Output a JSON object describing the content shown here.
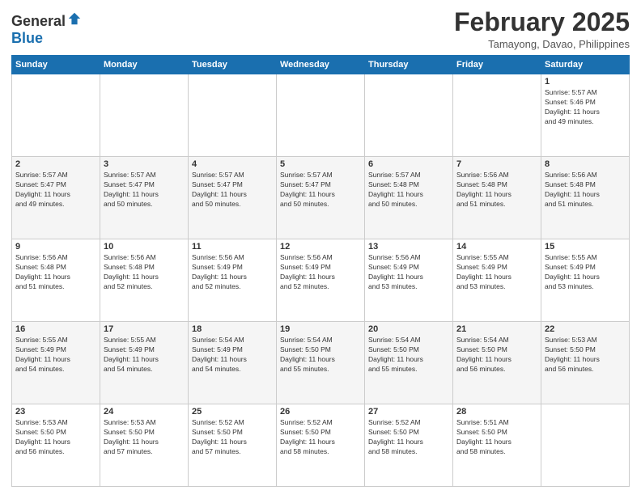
{
  "header": {
    "logo_general": "General",
    "logo_blue": "Blue",
    "month_title": "February 2025",
    "location": "Tamayong, Davao, Philippines"
  },
  "days_of_week": [
    "Sunday",
    "Monday",
    "Tuesday",
    "Wednesday",
    "Thursday",
    "Friday",
    "Saturday"
  ],
  "weeks": [
    [
      {
        "day": "",
        "info": ""
      },
      {
        "day": "",
        "info": ""
      },
      {
        "day": "",
        "info": ""
      },
      {
        "day": "",
        "info": ""
      },
      {
        "day": "",
        "info": ""
      },
      {
        "day": "",
        "info": ""
      },
      {
        "day": "1",
        "info": "Sunrise: 5:57 AM\nSunset: 5:46 PM\nDaylight: 11 hours\nand 49 minutes."
      }
    ],
    [
      {
        "day": "2",
        "info": "Sunrise: 5:57 AM\nSunset: 5:47 PM\nDaylight: 11 hours\nand 49 minutes."
      },
      {
        "day": "3",
        "info": "Sunrise: 5:57 AM\nSunset: 5:47 PM\nDaylight: 11 hours\nand 50 minutes."
      },
      {
        "day": "4",
        "info": "Sunrise: 5:57 AM\nSunset: 5:47 PM\nDaylight: 11 hours\nand 50 minutes."
      },
      {
        "day": "5",
        "info": "Sunrise: 5:57 AM\nSunset: 5:47 PM\nDaylight: 11 hours\nand 50 minutes."
      },
      {
        "day": "6",
        "info": "Sunrise: 5:57 AM\nSunset: 5:48 PM\nDaylight: 11 hours\nand 50 minutes."
      },
      {
        "day": "7",
        "info": "Sunrise: 5:56 AM\nSunset: 5:48 PM\nDaylight: 11 hours\nand 51 minutes."
      },
      {
        "day": "8",
        "info": "Sunrise: 5:56 AM\nSunset: 5:48 PM\nDaylight: 11 hours\nand 51 minutes."
      }
    ],
    [
      {
        "day": "9",
        "info": "Sunrise: 5:56 AM\nSunset: 5:48 PM\nDaylight: 11 hours\nand 51 minutes."
      },
      {
        "day": "10",
        "info": "Sunrise: 5:56 AM\nSunset: 5:48 PM\nDaylight: 11 hours\nand 52 minutes."
      },
      {
        "day": "11",
        "info": "Sunrise: 5:56 AM\nSunset: 5:49 PM\nDaylight: 11 hours\nand 52 minutes."
      },
      {
        "day": "12",
        "info": "Sunrise: 5:56 AM\nSunset: 5:49 PM\nDaylight: 11 hours\nand 52 minutes."
      },
      {
        "day": "13",
        "info": "Sunrise: 5:56 AM\nSunset: 5:49 PM\nDaylight: 11 hours\nand 53 minutes."
      },
      {
        "day": "14",
        "info": "Sunrise: 5:55 AM\nSunset: 5:49 PM\nDaylight: 11 hours\nand 53 minutes."
      },
      {
        "day": "15",
        "info": "Sunrise: 5:55 AM\nSunset: 5:49 PM\nDaylight: 11 hours\nand 53 minutes."
      }
    ],
    [
      {
        "day": "16",
        "info": "Sunrise: 5:55 AM\nSunset: 5:49 PM\nDaylight: 11 hours\nand 54 minutes."
      },
      {
        "day": "17",
        "info": "Sunrise: 5:55 AM\nSunset: 5:49 PM\nDaylight: 11 hours\nand 54 minutes."
      },
      {
        "day": "18",
        "info": "Sunrise: 5:54 AM\nSunset: 5:49 PM\nDaylight: 11 hours\nand 54 minutes."
      },
      {
        "day": "19",
        "info": "Sunrise: 5:54 AM\nSunset: 5:50 PM\nDaylight: 11 hours\nand 55 minutes."
      },
      {
        "day": "20",
        "info": "Sunrise: 5:54 AM\nSunset: 5:50 PM\nDaylight: 11 hours\nand 55 minutes."
      },
      {
        "day": "21",
        "info": "Sunrise: 5:54 AM\nSunset: 5:50 PM\nDaylight: 11 hours\nand 56 minutes."
      },
      {
        "day": "22",
        "info": "Sunrise: 5:53 AM\nSunset: 5:50 PM\nDaylight: 11 hours\nand 56 minutes."
      }
    ],
    [
      {
        "day": "23",
        "info": "Sunrise: 5:53 AM\nSunset: 5:50 PM\nDaylight: 11 hours\nand 56 minutes."
      },
      {
        "day": "24",
        "info": "Sunrise: 5:53 AM\nSunset: 5:50 PM\nDaylight: 11 hours\nand 57 minutes."
      },
      {
        "day": "25",
        "info": "Sunrise: 5:52 AM\nSunset: 5:50 PM\nDaylight: 11 hours\nand 57 minutes."
      },
      {
        "day": "26",
        "info": "Sunrise: 5:52 AM\nSunset: 5:50 PM\nDaylight: 11 hours\nand 58 minutes."
      },
      {
        "day": "27",
        "info": "Sunrise: 5:52 AM\nSunset: 5:50 PM\nDaylight: 11 hours\nand 58 minutes."
      },
      {
        "day": "28",
        "info": "Sunrise: 5:51 AM\nSunset: 5:50 PM\nDaylight: 11 hours\nand 58 minutes."
      },
      {
        "day": "",
        "info": ""
      }
    ]
  ]
}
